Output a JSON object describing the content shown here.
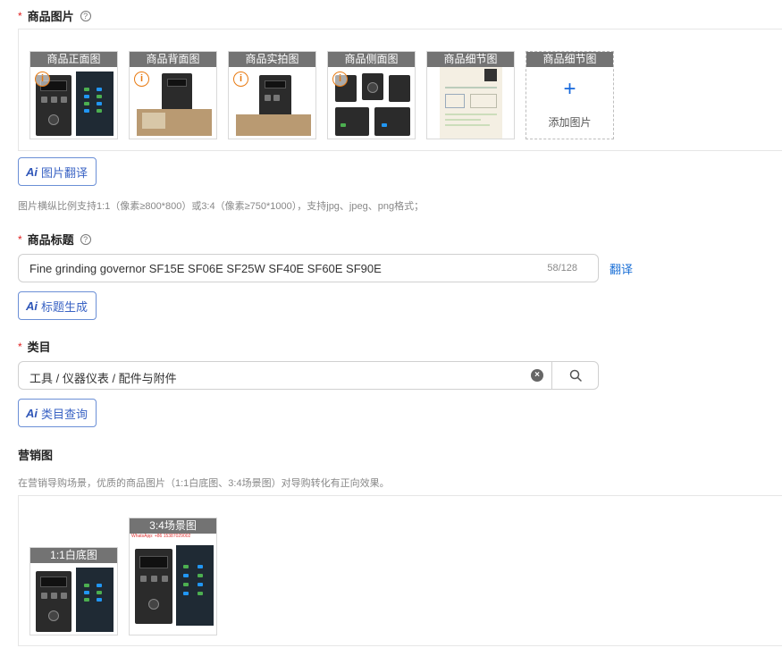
{
  "images_field": {
    "label": "商品图片",
    "thumbs": [
      {
        "caption": "商品正面图"
      },
      {
        "caption": "商品背面图"
      },
      {
        "caption": "商品实拍图"
      },
      {
        "caption": "商品侧面图"
      },
      {
        "caption": "商品细节图"
      },
      {
        "caption": "商品细节图"
      }
    ],
    "add_label": "添加图片",
    "ai_button": "图片翻译",
    "hint": "图片横纵比例支持1:1（像素≥800*800）或3:4（像素≥750*1000），支持jpg、jpeg、png格式；"
  },
  "title_field": {
    "label": "商品标题",
    "value": "Fine grinding governor SF15E SF06E SF25W SF40E SF60E SF90E",
    "count": "58/128",
    "translate_link": "翻译",
    "ai_button": "标题生成"
  },
  "category_field": {
    "label": "类目",
    "value": "工具 / 仪器仪表 / 配件与附件",
    "ai_button": "类目查询"
  },
  "marketing_field": {
    "label": "营销图",
    "hint": "在营销导购场景，优质的商品图片（1:1白底图、3:4场景图）对导购转化有正向效果。",
    "thumbs": [
      {
        "caption": "1:1白底图"
      },
      {
        "caption": "3:4场景图"
      }
    ],
    "watermark": "WhatsApp: +86 15387029002"
  },
  "icons": {
    "required_mark": "*",
    "help": "?",
    "warning": "i",
    "clear": "×",
    "plus": "+",
    "ai": "Ai"
  },
  "colors": {
    "accent": "#1a6fd6",
    "required": "#e02020",
    "warning": "#e87a12"
  }
}
